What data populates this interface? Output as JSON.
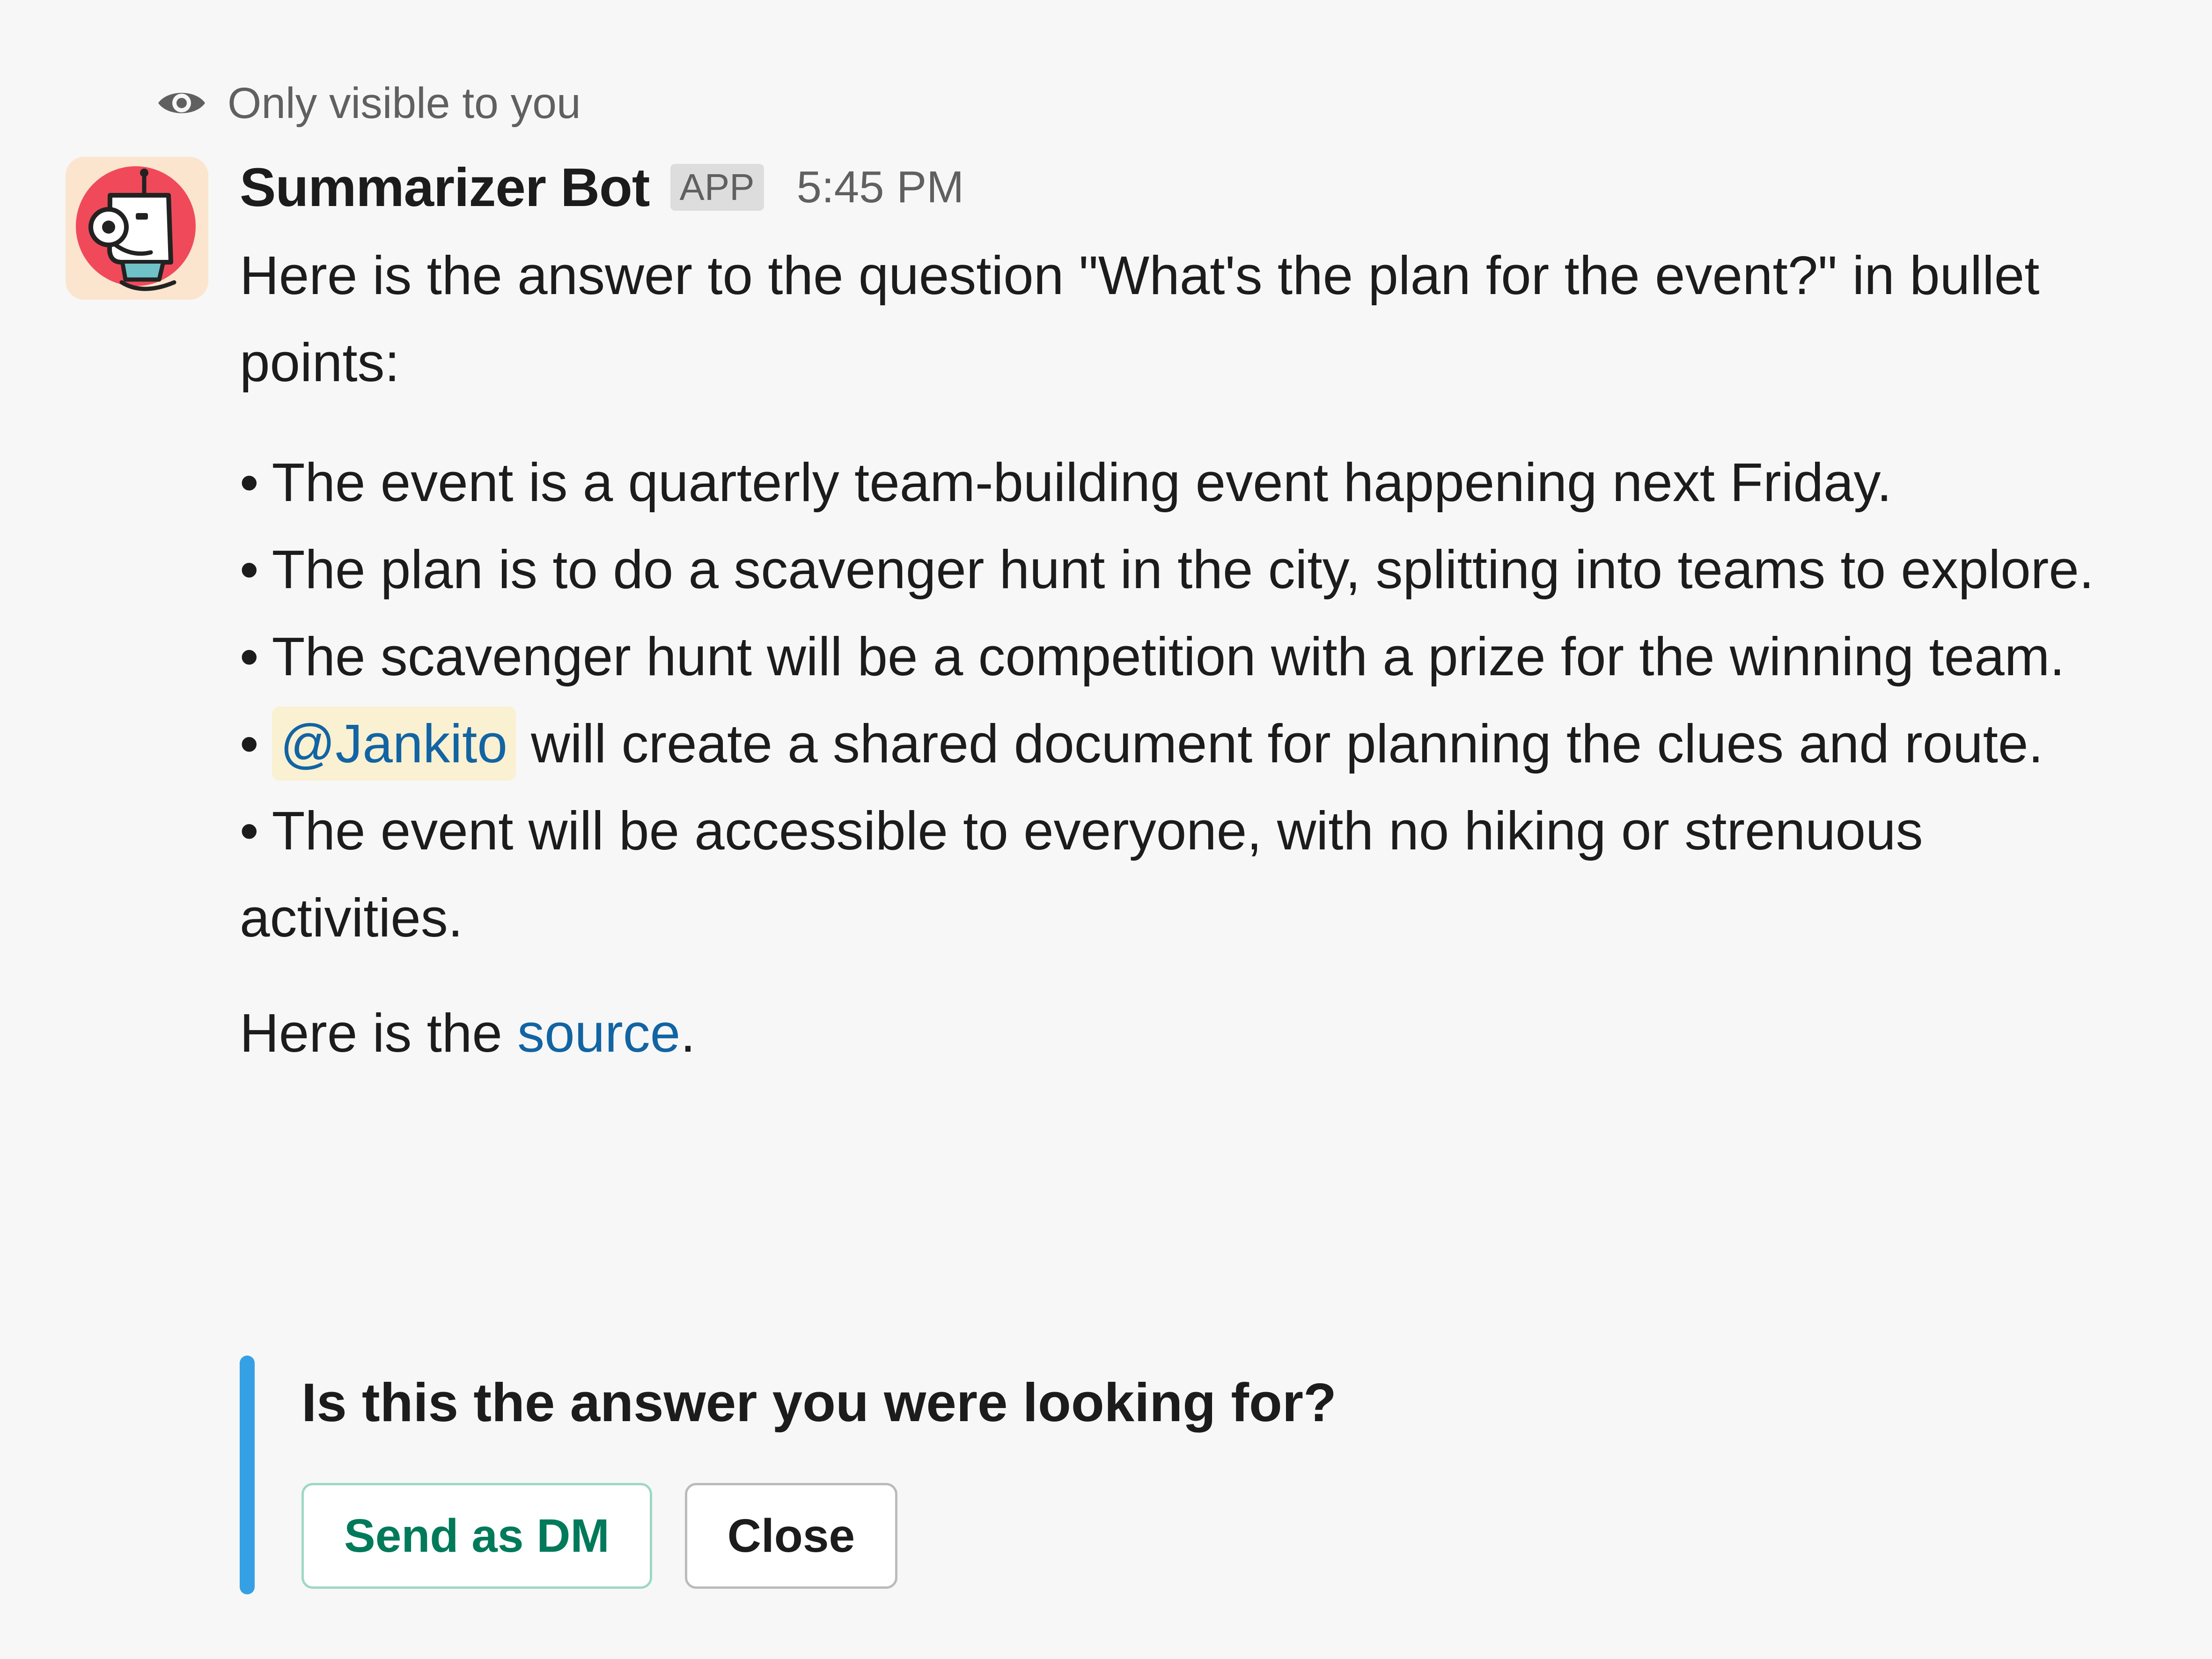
{
  "visibility_note": {
    "icon": "eye-icon",
    "text": "Only visible to you"
  },
  "message": {
    "avatar": {
      "icon": "robot-headset-icon",
      "colors": {
        "background": "#fbe5cf",
        "circle": "#f04a5a"
      }
    },
    "sender": "Summarizer Bot",
    "badge": "APP",
    "timestamp": "5:45 PM",
    "intro": "Here is the answer to the question \"What's the plan for the event?\" in bullet points:",
    "bullets": [
      {
        "text": "The event is a quarterly team-building event happening next Friday."
      },
      {
        "text": "The plan is to do a scavenger hunt in the city, splitting into teams to explore."
      },
      {
        "text": "The scavenger hunt will be a competition with a prize for the winning team."
      },
      {
        "mention": "@Jankito",
        "text": "will create a shared document for planning the clues and route."
      },
      {
        "text": "The event will be accessible to everyone, with no hiking or strenuous activities."
      }
    ],
    "bullet_char": "•",
    "source": {
      "prefix": "Here is the ",
      "link_text": "source",
      "suffix": "."
    }
  },
  "attachment": {
    "title": "Is this the answer you were looking for?",
    "buttons": {
      "send_dm": "Send as DM",
      "close": "Close"
    },
    "colors": {
      "bar": "#36a0e5",
      "primary_text": "#007a5a"
    }
  },
  "colors": {
    "mention_bg": "#faf0d2",
    "link": "#1264a3",
    "muted_text": "#616061"
  }
}
